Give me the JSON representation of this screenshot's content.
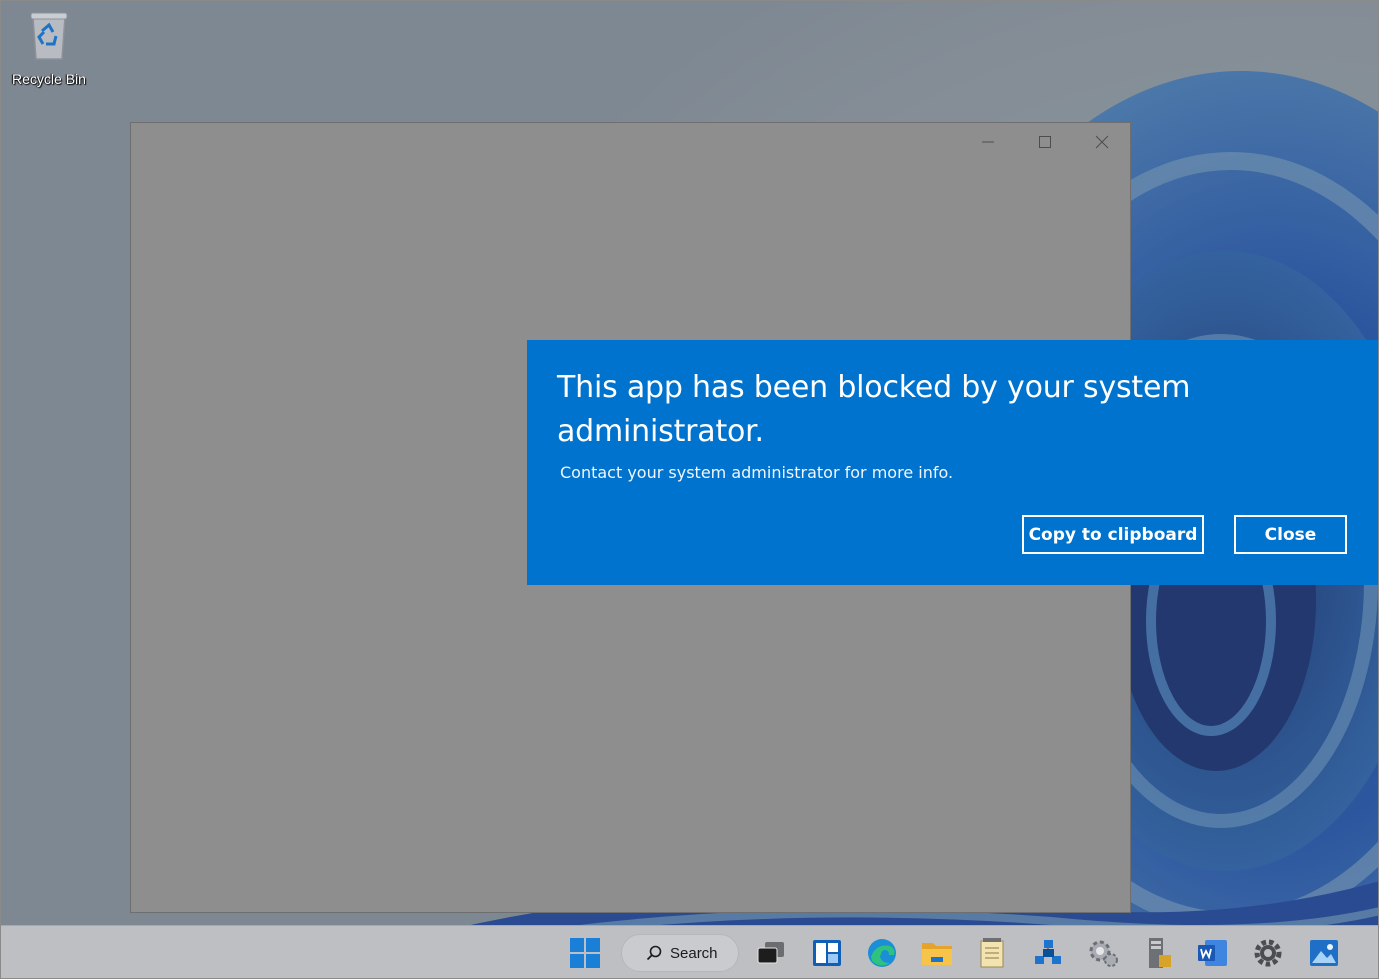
{
  "desktop": {
    "recycle_bin_label": "Recycle Bin"
  },
  "toast": {
    "title": "This app has been blocked by your system administrator.",
    "message": "Contact your system administrator for more info.",
    "copy_button": "Copy to clipboard",
    "close_button": "Close",
    "background_color": "#0073cf"
  },
  "taskbar": {
    "search_label": "Search",
    "pinned_icons": [
      "start-icon",
      "search-icon",
      "task-view-icon",
      "widgets-icon",
      "edge-icon",
      "file-explorer-icon",
      "notepad-icon",
      "network-icon",
      "system-settings-icon",
      "server-manager-icon",
      "word-icon",
      "settings-gear-icon",
      "photos-icon"
    ]
  }
}
